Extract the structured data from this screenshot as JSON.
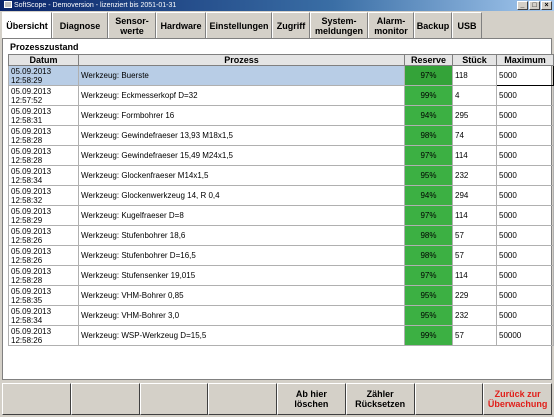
{
  "window": {
    "title": "SoftScope - Demoversion - lizenziert bis 2051-01-31"
  },
  "tabs": [
    {
      "label": "Übersicht",
      "width": 50
    },
    {
      "label": "Diagnose",
      "width": 56
    },
    {
      "label": "Sensor-\nwerte",
      "width": 48
    },
    {
      "label": "Hardware",
      "width": 50
    },
    {
      "label": "Einstellungen",
      "width": 66
    },
    {
      "label": "Zugriff",
      "width": 38
    },
    {
      "label": "System-\nmeldungen",
      "width": 58
    },
    {
      "label": "Alarm-\nmonitor",
      "width": 46
    },
    {
      "label": "Backup",
      "width": 38
    },
    {
      "label": "USB",
      "width": 30
    }
  ],
  "section_title": "Prozesszustand",
  "columns": {
    "date": "Datum",
    "process": "Prozess",
    "reserve": "Reserve",
    "count": "Stück",
    "max": "Maximum"
  },
  "rows": [
    {
      "date": "05.09.2013",
      "time": "12:58:29",
      "process": "Werkzeug: Buerste",
      "reserve": "97%",
      "count": "118",
      "max": "5000"
    },
    {
      "date": "05.09.2013",
      "time": "12:57:52",
      "process": "Werkzeug: Eckmesserkopf D=32",
      "reserve": "99%",
      "count": "4",
      "max": "5000"
    },
    {
      "date": "05.09.2013",
      "time": "12:58:31",
      "process": "Werkzeug: Formbohrer 16",
      "reserve": "94%",
      "count": "295",
      "max": "5000"
    },
    {
      "date": "05.09.2013",
      "time": "12:58:28",
      "process": "Werkzeug: Gewindefraeser 13,93 M18x1,5",
      "reserve": "98%",
      "count": "74",
      "max": "5000"
    },
    {
      "date": "05.09.2013",
      "time": "12:58:28",
      "process": "Werkzeug: Gewindefraeser 15,49 M24x1,5",
      "reserve": "97%",
      "count": "114",
      "max": "5000"
    },
    {
      "date": "05.09.2013",
      "time": "12:58:34",
      "process": "Werkzeug: Glockenfraeser M14x1,5",
      "reserve": "95%",
      "count": "232",
      "max": "5000"
    },
    {
      "date": "05.09.2013",
      "time": "12:58:32",
      "process": "Werkzeug: Glockenwerkzeug 14, R 0,4",
      "reserve": "94%",
      "count": "294",
      "max": "5000"
    },
    {
      "date": "05.09.2013",
      "time": "12:58:29",
      "process": "Werkzeug: Kugelfraeser D=8",
      "reserve": "97%",
      "count": "114",
      "max": "5000"
    },
    {
      "date": "05.09.2013",
      "time": "12:58:26",
      "process": "Werkzeug: Stufenbohrer 18,6",
      "reserve": "98%",
      "count": "57",
      "max": "5000"
    },
    {
      "date": "05.09.2013",
      "time": "12:58:26",
      "process": "Werkzeug: Stufenbohrer D=16,5",
      "reserve": "98%",
      "count": "57",
      "max": "5000"
    },
    {
      "date": "05.09.2013",
      "time": "12:58:28",
      "process": "Werkzeug: Stufensenker 19,015",
      "reserve": "97%",
      "count": "114",
      "max": "5000"
    },
    {
      "date": "05.09.2013",
      "time": "12:58:35",
      "process": "Werkzeug: VHM-Bohrer 0,85",
      "reserve": "95%",
      "count": "229",
      "max": "5000"
    },
    {
      "date": "05.09.2013",
      "time": "12:58:34",
      "process": "Werkzeug: VHM-Bohrer 3,0",
      "reserve": "95%",
      "count": "232",
      "max": "5000"
    },
    {
      "date": "05.09.2013",
      "time": "12:58:26",
      "process": "Werkzeug: WSP-Werkzeug D=15,5",
      "reserve": "99%",
      "count": "57",
      "max": "50000"
    }
  ],
  "footer": {
    "buttons": [
      {
        "label": ""
      },
      {
        "label": ""
      },
      {
        "label": ""
      },
      {
        "label": ""
      },
      {
        "label": "Ab hier\nlöschen"
      },
      {
        "label": "Zähler\nRücksetzen"
      },
      {
        "label": ""
      },
      {
        "label": "Zurück zur\nÜberwachung",
        "color": "#e0201b"
      }
    ]
  },
  "colors": {
    "reserve_green": "#3cb043",
    "selected_row": "#b8cde6",
    "accent_red": "#e0201b"
  }
}
